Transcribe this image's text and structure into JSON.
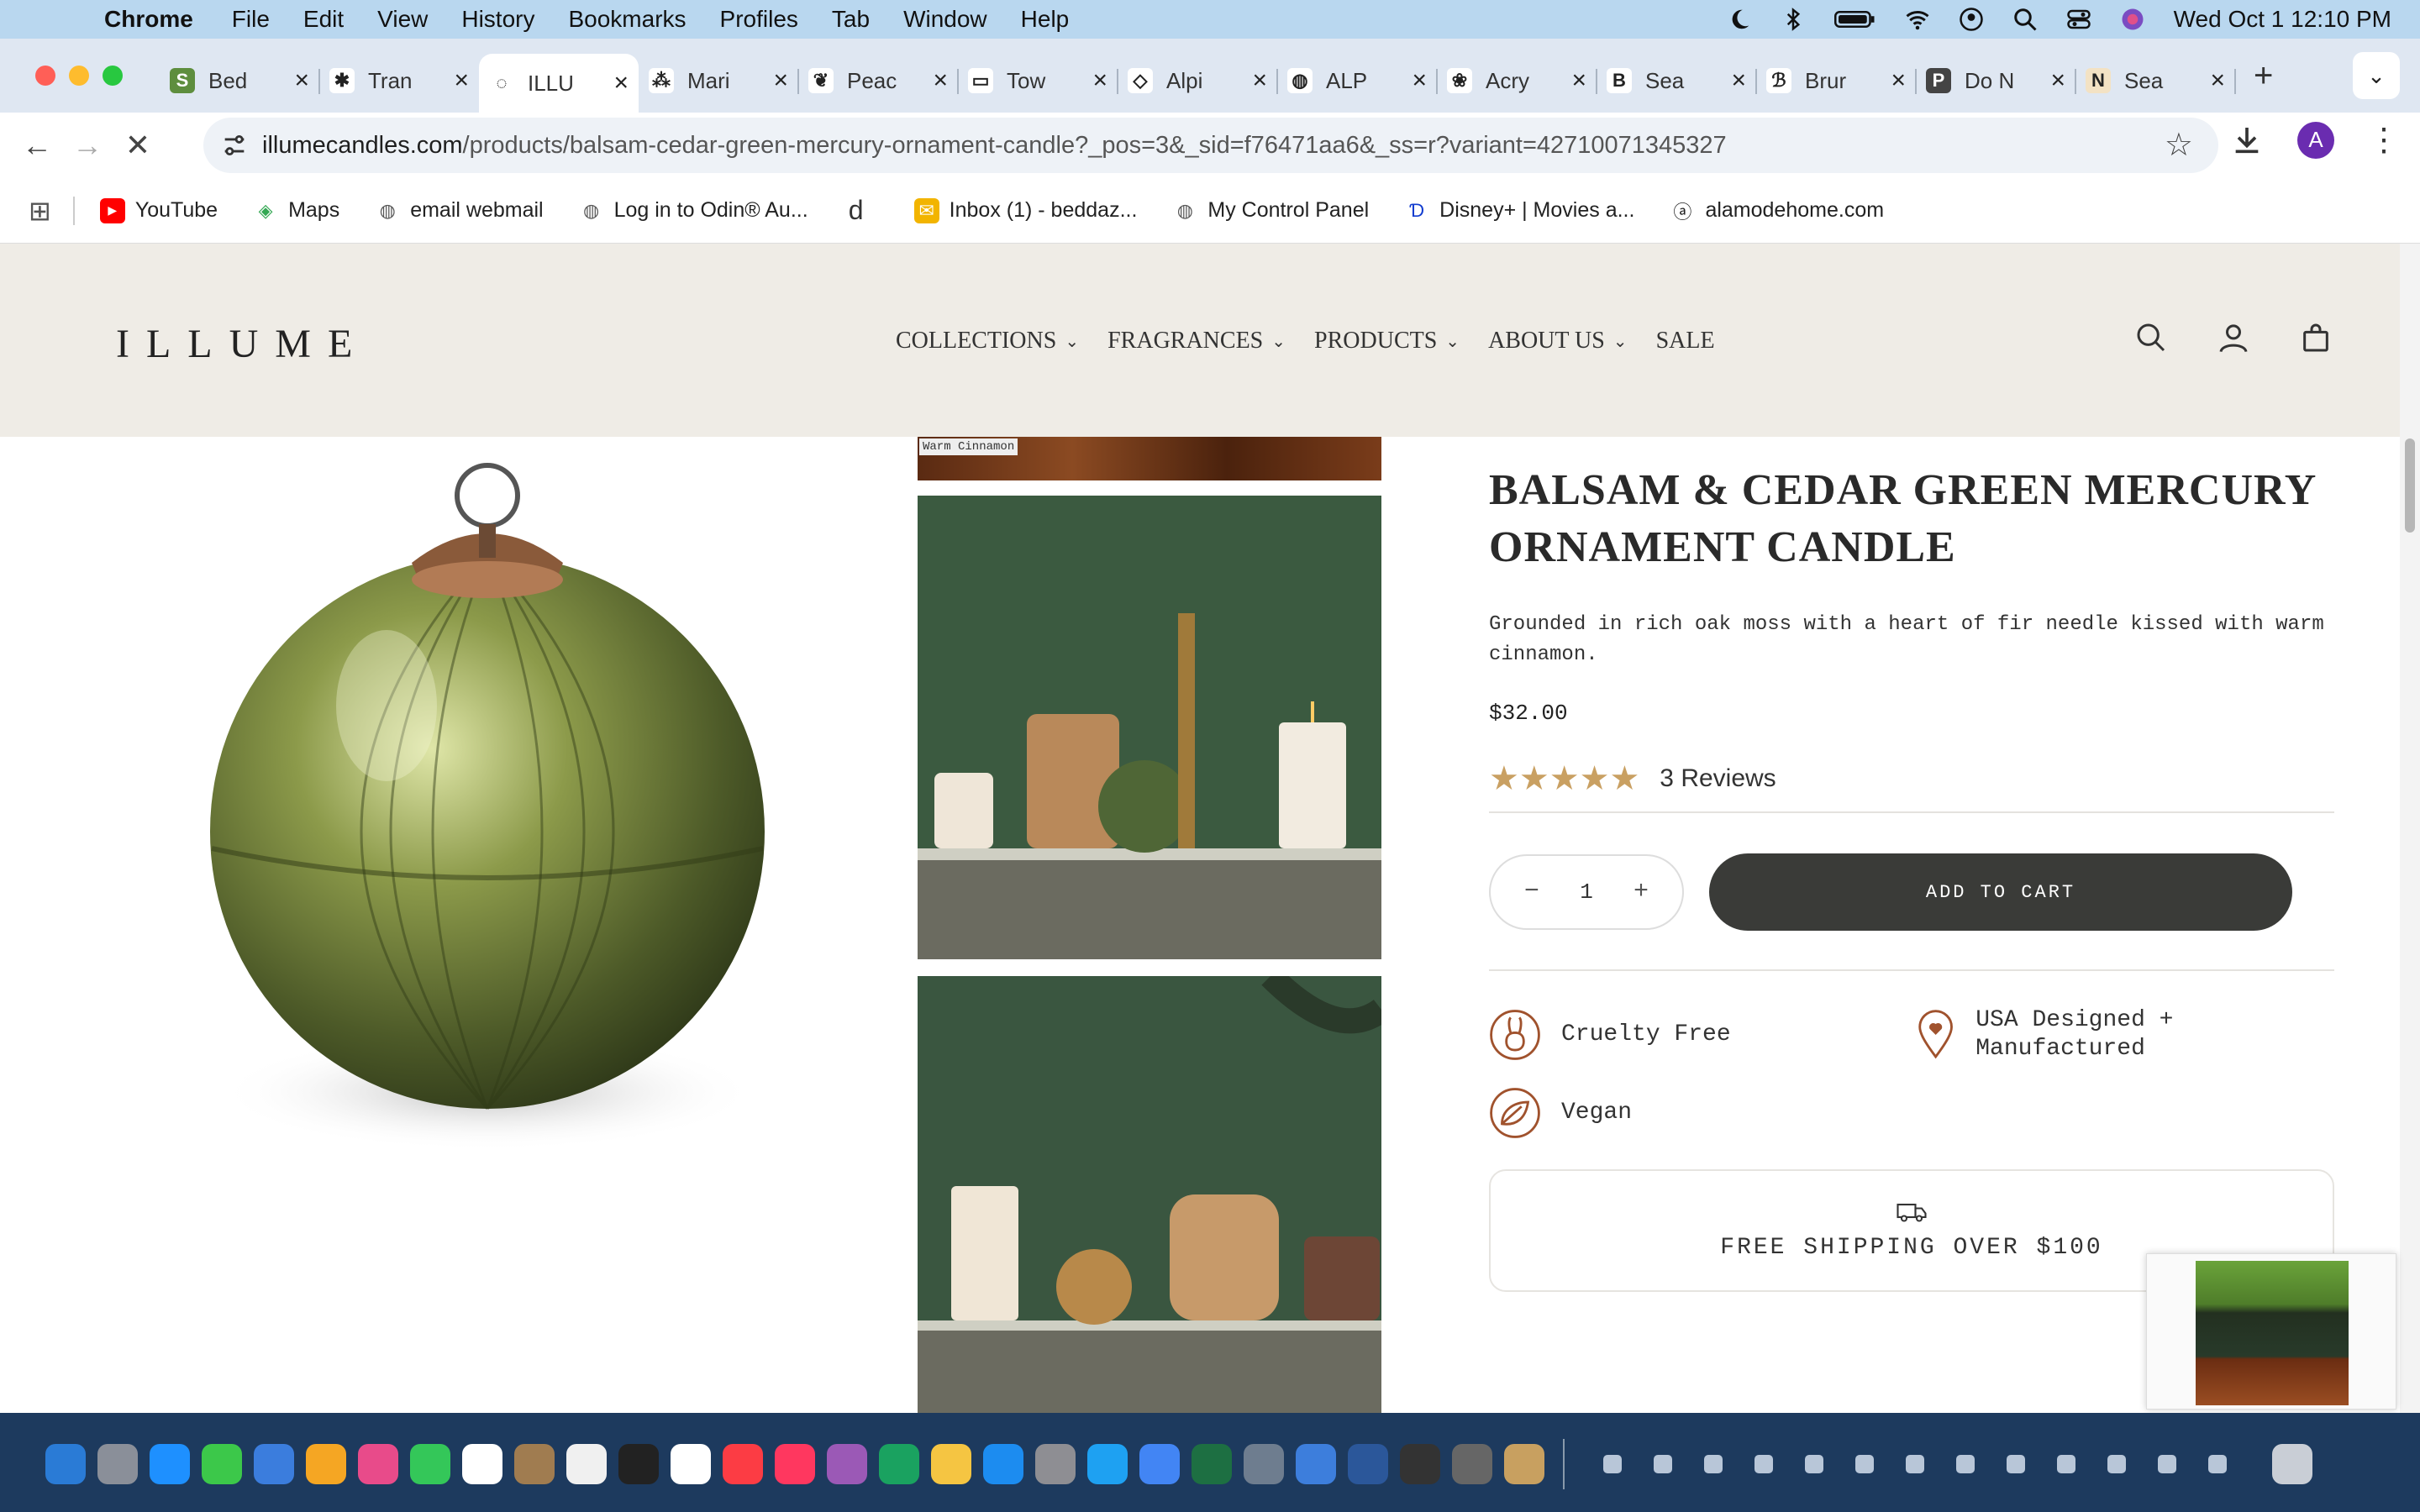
{
  "menubar": {
    "app": "Chrome",
    "items": [
      "File",
      "Edit",
      "View",
      "History",
      "Bookmarks",
      "Profiles",
      "Tab",
      "Window",
      "Help"
    ],
    "datetime": "Wed Oct 1  12:10 PM"
  },
  "tabs": [
    {
      "title": "Bed",
      "fav_color": "#5e8e3e",
      "fav_glyph": "S"
    },
    {
      "title": "Tran",
      "fav_color": "#ffffff",
      "fav_glyph": "✱"
    },
    {
      "title": "ILLU",
      "fav_color": "#ffffff",
      "fav_glyph": "◌"
    },
    {
      "title": "Mari",
      "fav_color": "#ffffff",
      "fav_glyph": "⁂"
    },
    {
      "title": "Peac",
      "fav_color": "#ffffff",
      "fav_glyph": "❦"
    },
    {
      "title": "Tow",
      "fav_color": "#ffffff",
      "fav_glyph": "▭"
    },
    {
      "title": "Alpi",
      "fav_color": "#ffffff",
      "fav_glyph": "◇"
    },
    {
      "title": "ALP",
      "fav_color": "#ffffff",
      "fav_glyph": "◍"
    },
    {
      "title": "Acry",
      "fav_color": "#ffffff",
      "fav_glyph": "❀"
    },
    {
      "title": "Sea",
      "fav_color": "#ffffff",
      "fav_glyph": "B"
    },
    {
      "title": "Brur",
      "fav_color": "#ffffff",
      "fav_glyph": "ℬ"
    },
    {
      "title": "Do N",
      "fav_color": "#444444",
      "fav_glyph": "P"
    },
    {
      "title": "Sea",
      "fav_color": "#f3e2c4",
      "fav_glyph": "N"
    }
  ],
  "address": {
    "host": "illumecandles.com",
    "path": "/products/balsam-cedar-green-mercury-ornament-candle?_pos=3&_sid=f76471aa6&_ss=r?variant=42710071345327"
  },
  "avatar_letter": "A",
  "bookmarks": [
    {
      "label": "YouTube",
      "icon": "youtube-icon",
      "color": "#ff0000"
    },
    {
      "label": "Maps",
      "icon": "maps-icon",
      "color": "#34a853"
    },
    {
      "label": "email webmail",
      "icon": "globe-icon",
      "color": "#555555"
    },
    {
      "label": "Log in to Odin® Au...",
      "icon": "globe-icon",
      "color": "#555555"
    },
    {
      "label": "",
      "icon": "d-icon",
      "color": "#333333"
    },
    {
      "label": "Inbox (1) - beddaz...",
      "icon": "mail-icon",
      "color": "#f2b400"
    },
    {
      "label": "My Control Panel",
      "icon": "globe-icon",
      "color": "#555555"
    },
    {
      "label": "Disney+ | Movies a...",
      "icon": "disney-icon",
      "color": "#113ccf"
    },
    {
      "label": "alamodehome.com",
      "icon": "a-icon",
      "color": "#222222"
    }
  ],
  "site": {
    "logo": "ILLUME",
    "nav": [
      {
        "label": "COLLECTIONS",
        "dropdown": true
      },
      {
        "label": "FRAGRANCES",
        "dropdown": true
      },
      {
        "label": "PRODUCTS",
        "dropdown": true
      },
      {
        "label": "ABOUT US",
        "dropdown": true
      },
      {
        "label": "SALE",
        "dropdown": false
      }
    ]
  },
  "gallery": {
    "tag": "Warm Cinnamon"
  },
  "product": {
    "title": "BALSAM & CEDAR GREEN MERCURY ORNAMENT CANDLE",
    "description": "Grounded in rich oak moss with a heart of fir needle kissed with warm cinnamon.",
    "price": "$32.00",
    "rating": 5,
    "stars": "★★★★★",
    "reviews": "3 Reviews",
    "quantity": "1",
    "add_to_cart": "ADD TO CART",
    "features": [
      {
        "label": "Cruelty Free",
        "icon": "rabbit-icon"
      },
      {
        "label": "USA Designed + Manufactured",
        "icon": "heart-pin-icon"
      },
      {
        "label": "Vegan",
        "icon": "leaf-icon"
      }
    ],
    "shipping": "FREE SHIPPING OVER $100"
  },
  "colors": {
    "header_bg": "#efece6",
    "atc_bg": "#3a3b38",
    "star": "#c9a062",
    "accent_icon": "#a0522d"
  }
}
